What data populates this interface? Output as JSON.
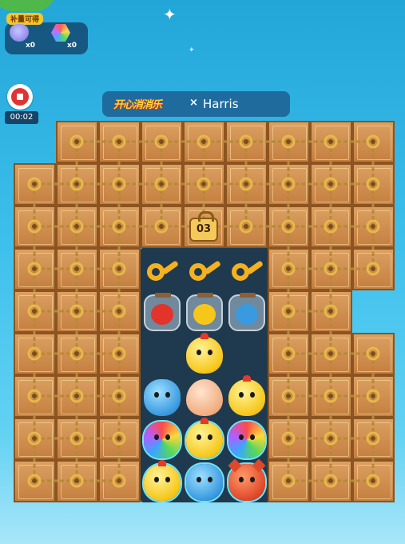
{
  "boosts": {
    "tag": "补量可得",
    "items": [
      {
        "icon": "bag-icon",
        "count": "x0"
      },
      {
        "icon": "hexagon-gem-icon",
        "count": "x0"
      }
    ]
  },
  "timer": "00:02",
  "header": {
    "game_logo": "开心消消乐",
    "vs_mark": "×",
    "opponent": "Harris"
  },
  "lock": {
    "count": "03"
  },
  "grid": {
    "columns": 9,
    "rows": 9,
    "row_shape": [
      "-++++++++",
      "+++++++++",
      "+++++++++",
      "+++...+++",
      "+++...++-",
      "+++...+++",
      "+++...+++",
      "+++...+++",
      "+++...+++"
    ],
    "tiles": [
      [
        "key",
        "key",
        "key"
      ],
      [
        "jar-red",
        "jar-yellow",
        "jar-blue"
      ],
      [
        "empty",
        "chick",
        "empty"
      ],
      [
        "blue",
        "egg",
        "chick"
      ],
      [
        "owl",
        "chick",
        "owl"
      ],
      [
        "chick",
        "blue",
        "fox"
      ]
    ]
  },
  "colors": {
    "sky_top": "#22a6d8",
    "crate": "#c47f40",
    "crate_border": "#8b5420",
    "rope": "#b68938",
    "panel": "#1f6b9e",
    "stop": "#e03434"
  }
}
